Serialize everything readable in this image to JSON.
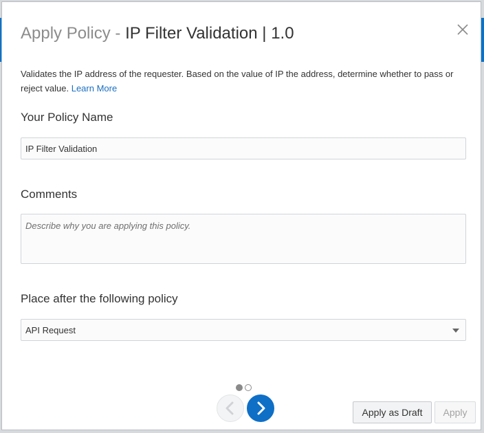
{
  "dialog": {
    "title_prefix": "Apply Policy",
    "title_dash": " - ",
    "title_policy": "IP Filter Validation",
    "title_sep": " | ",
    "title_version": "1.0"
  },
  "description": {
    "text": "Validates the IP address of the requester. Based on the value of IP the address, determine whether to pass or reject value.",
    "link_label": "Learn More"
  },
  "form": {
    "policy_name_label": "Your Policy Name",
    "policy_name_value": "IP Filter Validation",
    "comments_label": "Comments",
    "comments_placeholder": "Describe why you are applying this policy.",
    "place_after_label": "Place after the following policy",
    "place_after_value": "API Request"
  },
  "pagination": {
    "current_page": 1,
    "total_pages": 2
  },
  "footer": {
    "apply_draft_label": "Apply as Draft",
    "apply_label": "Apply"
  },
  "icons": {
    "close": "close-icon",
    "prev": "chevron-left-icon",
    "next": "chevron-right-icon",
    "dropdown": "caret-down-icon"
  },
  "colors": {
    "accent": "#0f6fc6",
    "link": "#1a6fc0",
    "muted_title": "#8c8c8c"
  }
}
